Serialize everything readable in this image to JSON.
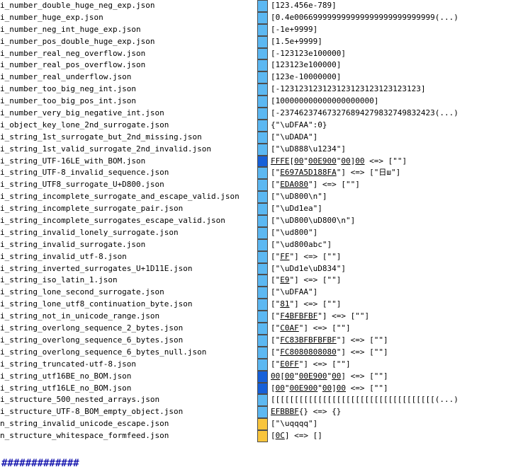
{
  "colors": {
    "light_blue": "#5cb8f2",
    "dark_blue": "#1760d8",
    "yellow": "#f8c53c",
    "border": "#4d4d4d"
  },
  "rows": [
    {
      "file": "i_number_double_huge_neg_exp.json",
      "status": "light_blue",
      "segs": [
        {
          "t": "[123.456e-789]"
        }
      ]
    },
    {
      "file": "i_number_huge_exp.json",
      "status": "light_blue",
      "segs": [
        {
          "t": "[0.4e006699999999999999999999999999(...)"
        }
      ]
    },
    {
      "file": "i_number_neg_int_huge_exp.json",
      "status": "light_blue",
      "segs": [
        {
          "t": "[-1e+9999]"
        }
      ]
    },
    {
      "file": "i_number_pos_double_huge_exp.json",
      "status": "light_blue",
      "segs": [
        {
          "t": "[1.5e+9999]"
        }
      ]
    },
    {
      "file": "i_number_real_neg_overflow.json",
      "status": "light_blue",
      "segs": [
        {
          "t": "[-123123e100000]"
        }
      ]
    },
    {
      "file": "i_number_real_pos_overflow.json",
      "status": "light_blue",
      "segs": [
        {
          "t": "[123123e100000]"
        }
      ]
    },
    {
      "file": "i_number_real_underflow.json",
      "status": "light_blue",
      "segs": [
        {
          "t": "[123e-10000000]"
        }
      ]
    },
    {
      "file": "i_number_too_big_neg_int.json",
      "status": "light_blue",
      "segs": [
        {
          "t": "[-123123123123123123123123123123]"
        }
      ]
    },
    {
      "file": "i_number_too_big_pos_int.json",
      "status": "light_blue",
      "segs": [
        {
          "t": "[100000000000000000000]"
        }
      ]
    },
    {
      "file": "i_number_very_big_negative_int.json",
      "status": "light_blue",
      "segs": [
        {
          "t": "[-237462374673276894279832749832423(...)"
        }
      ]
    },
    {
      "file": "i_object_key_lone_2nd_surrogate.json",
      "status": "light_blue",
      "segs": [
        {
          "t": "{\"\\uDFAA\":0}"
        }
      ]
    },
    {
      "file": "i_string_1st_surrogate_but_2nd_missing.json",
      "status": "light_blue",
      "segs": [
        {
          "t": "[\"\\uDADA\"]"
        }
      ]
    },
    {
      "file": "i_string_1st_valid_surrogate_2nd_invalid.json",
      "status": "light_blue",
      "segs": [
        {
          "t": "[\"\\uD888\\u1234\"]"
        }
      ]
    },
    {
      "file": "i_string_UTF-16LE_with_BOM.json",
      "status": "dark_blue",
      "segs": [
        {
          "t": "FFFE",
          "u": true
        },
        {
          "t": "["
        },
        {
          "t": "00",
          "u": true
        },
        {
          "t": "\""
        },
        {
          "t": "00E900",
          "u": true
        },
        {
          "t": "\""
        },
        {
          "t": "00",
          "u": true
        },
        {
          "t": "]"
        },
        {
          "t": "00",
          "u": true
        },
        {
          "t": " <=> [\"\"]"
        }
      ]
    },
    {
      "file": "i_string_UTF-8_invalid_sequence.json",
      "status": "light_blue",
      "segs": [
        {
          "t": "[\""
        },
        {
          "t": "E697A5D188FA",
          "u": true
        },
        {
          "t": "\"] <=> [\"日ш\"]"
        }
      ]
    },
    {
      "file": "i_string_UTF8_surrogate_U+D800.json",
      "status": "light_blue",
      "segs": [
        {
          "t": "[\""
        },
        {
          "t": "EDA080",
          "u": true
        },
        {
          "t": "\"] <=> [\"\"]"
        }
      ]
    },
    {
      "file": "i_string_incomplete_surrogate_and_escape_valid.json",
      "status": "light_blue",
      "segs": [
        {
          "t": "[\"\\uD800\\n\"]"
        }
      ]
    },
    {
      "file": "i_string_incomplete_surrogate_pair.json",
      "status": "light_blue",
      "segs": [
        {
          "t": "[\"\\uDd1ea\"]"
        }
      ]
    },
    {
      "file": "i_string_incomplete_surrogates_escape_valid.json",
      "status": "light_blue",
      "segs": [
        {
          "t": "[\"\\uD800\\uD800\\n\"]"
        }
      ]
    },
    {
      "file": "i_string_invalid_lonely_surrogate.json",
      "status": "light_blue",
      "segs": [
        {
          "t": "[\"\\ud800\"]"
        }
      ]
    },
    {
      "file": "i_string_invalid_surrogate.json",
      "status": "light_blue",
      "segs": [
        {
          "t": "[\"\\ud800abc\"]"
        }
      ]
    },
    {
      "file": "i_string_invalid_utf-8.json",
      "status": "light_blue",
      "segs": [
        {
          "t": "[\""
        },
        {
          "t": "FF",
          "u": true
        },
        {
          "t": "\"] <=> [\"\"]"
        }
      ]
    },
    {
      "file": "i_string_inverted_surrogates_U+1D11E.json",
      "status": "light_blue",
      "segs": [
        {
          "t": "[\"\\uDd1e\\uD834\"]"
        }
      ]
    },
    {
      "file": "i_string_iso_latin_1.json",
      "status": "light_blue",
      "segs": [
        {
          "t": "[\""
        },
        {
          "t": "E9",
          "u": true
        },
        {
          "t": "\"] <=> [\"\"]"
        }
      ]
    },
    {
      "file": "i_string_lone_second_surrogate.json",
      "status": "light_blue",
      "segs": [
        {
          "t": "[\"\\uDFAA\"]"
        }
      ]
    },
    {
      "file": "i_string_lone_utf8_continuation_byte.json",
      "status": "light_blue",
      "segs": [
        {
          "t": "[\""
        },
        {
          "t": "81",
          "u": true
        },
        {
          "t": "\"] <=> [\"\"]"
        }
      ]
    },
    {
      "file": "i_string_not_in_unicode_range.json",
      "status": "light_blue",
      "segs": [
        {
          "t": "[\""
        },
        {
          "t": "F4BFBFBF",
          "u": true
        },
        {
          "t": "\"] <=> [\"\"]"
        }
      ]
    },
    {
      "file": "i_string_overlong_sequence_2_bytes.json",
      "status": "light_blue",
      "segs": [
        {
          "t": "[\""
        },
        {
          "t": "C0AF",
          "u": true
        },
        {
          "t": "\"] <=> [\"\"]"
        }
      ]
    },
    {
      "file": "i_string_overlong_sequence_6_bytes.json",
      "status": "light_blue",
      "segs": [
        {
          "t": "[\""
        },
        {
          "t": "FC83BFBFBFBF",
          "u": true
        },
        {
          "t": "\"] <=> [\"\"]"
        }
      ]
    },
    {
      "file": "i_string_overlong_sequence_6_bytes_null.json",
      "status": "light_blue",
      "segs": [
        {
          "t": "[\""
        },
        {
          "t": "FC8080808080",
          "u": true
        },
        {
          "t": "\"] <=> [\"\"]"
        }
      ]
    },
    {
      "file": "i_string_truncated-utf-8.json",
      "status": "light_blue",
      "segs": [
        {
          "t": "[\""
        },
        {
          "t": "E0FF",
          "u": true
        },
        {
          "t": "\"] <=> [\"\"]"
        }
      ]
    },
    {
      "file": "i_string_utf16BE_no_BOM.json",
      "status": "dark_blue",
      "segs": [
        {
          "t": "00",
          "u": true
        },
        {
          "t": "["
        },
        {
          "t": "00",
          "u": true
        },
        {
          "t": "\""
        },
        {
          "t": "00E900",
          "u": true
        },
        {
          "t": "\""
        },
        {
          "t": "00",
          "u": true
        },
        {
          "t": "] <=> [\"\"]"
        }
      ]
    },
    {
      "file": "i_string_utf16LE_no_BOM.json",
      "status": "dark_blue",
      "segs": [
        {
          "t": "["
        },
        {
          "t": "00",
          "u": true
        },
        {
          "t": "\""
        },
        {
          "t": "00E900",
          "u": true
        },
        {
          "t": "\""
        },
        {
          "t": "00",
          "u": true
        },
        {
          "t": "]"
        },
        {
          "t": "00",
          "u": true
        },
        {
          "t": " <=> [\"\"]"
        }
      ]
    },
    {
      "file": "i_structure_500_nested_arrays.json",
      "status": "light_blue",
      "segs": [
        {
          "t": "[[[[[[[[[[[[[[[[[[[[[[[[[[[[[[[[[[[(...)"
        }
      ]
    },
    {
      "file": "i_structure_UTF-8_BOM_empty_object.json",
      "status": "light_blue",
      "segs": [
        {
          "t": "EFBBBF",
          "u": true
        },
        {
          "t": "{} <=> {}"
        }
      ]
    },
    {
      "file": "n_string_invalid_unicode_escape.json",
      "status": "yellow",
      "segs": [
        {
          "t": "[\"\\uqqqq\"]"
        }
      ]
    },
    {
      "file": "n_structure_whitespace_formfeed.json",
      "status": "yellow",
      "segs": [
        {
          "t": "["
        },
        {
          "t": "0C",
          "u": true
        },
        {
          "t": "] <=> []"
        }
      ]
    }
  ],
  "footer": {
    "partial_heading": "#############"
  }
}
